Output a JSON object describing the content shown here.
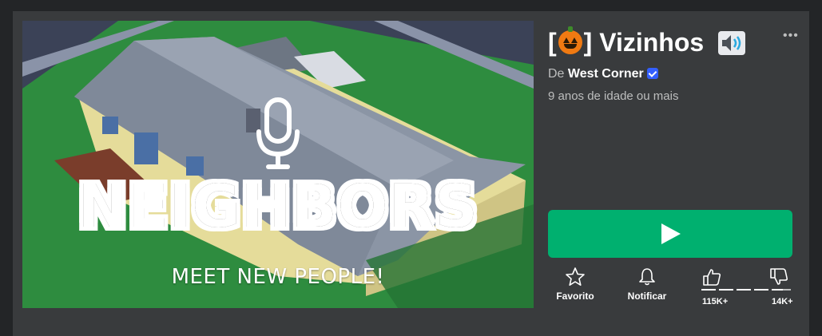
{
  "thumbnail": {
    "title": "NEIGHBORS",
    "subtitle": "MEET NEW PEOPLE!"
  },
  "game": {
    "title_prefix": "[",
    "title_suffix": "] Vizinhos",
    "title_emoji": "jack-o-lantern-icon",
    "title_sound_icon": "speaker-icon",
    "creator_prefix": "De",
    "creator_name": "West Corner",
    "creator_verified": true,
    "age_rating": "9 anos de idade ou mais"
  },
  "actions": {
    "favorite_label": "Favorito",
    "notify_label": "Notificar",
    "upvotes": "115K+",
    "downvotes": "14K+"
  },
  "colors": {
    "background": "#232527",
    "panel": "#393b3d",
    "play_button": "#00b06f",
    "verified_badge": "#335fff"
  }
}
